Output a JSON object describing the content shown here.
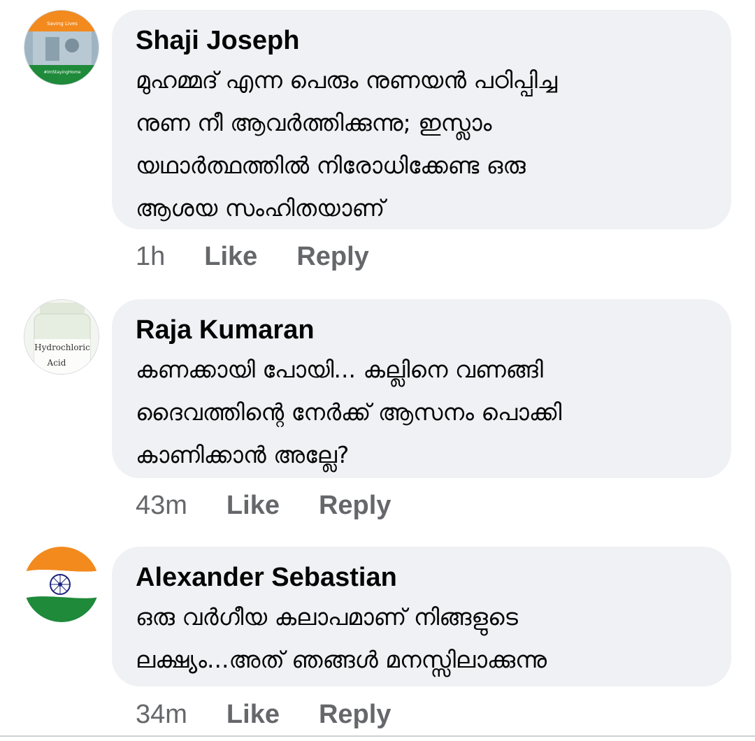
{
  "comments": [
    {
      "author": "Shaji Joseph",
      "text": "മുഹമ്മദ് എന്ന പെരും നുണയൻ പഠിപ്പിച്ച\nനുണ നീ ആവർത്തിക്കുന്നു; ഇസ്ലാം\nയഥാർത്ഥത്തിൽ നിരോധിക്കേണ്ട ഒരു\nആശയ സംഹിതയാണ്",
      "time": "1h",
      "like": "Like",
      "reply": "Reply",
      "avatar": {
        "top_text": "Saving Lives",
        "bottom_text": "#ImStayingHome",
        "icon": "covid-frame-avatar"
      }
    },
    {
      "author": "Raja Kumaran",
      "text": "കണക്കായി പോയി... കല്ലിനെ വണങ്ങി\nദൈവത്തിന്റെ നേർക്ക് ആസനം പൊക്കി\nകാണിക്കാൻ അല്ലേ?",
      "time": "43m",
      "like": "Like",
      "reply": "Reply",
      "avatar": {
        "line1": "Hydrochloric",
        "line2": "Acid",
        "icon": "bottle-avatar"
      }
    },
    {
      "author": "Alexander Sebastian",
      "text": "ഒരു വർഗീയ കലാപമാണ് നിങ്ങളുടെ\nലക്ഷ്യം...അത് ഞങ്ങൾ മനസ്സിലാക്കുന്നു",
      "time": "34m",
      "like": "Like",
      "reply": "Reply",
      "avatar": {
        "icon": "india-flag-avatar"
      }
    }
  ],
  "colors": {
    "bubble": "#eff1f4",
    "meta": "#65676b",
    "saffron": "#f28a1e",
    "green": "#1e8a3a",
    "chakra": "#1a237e"
  }
}
